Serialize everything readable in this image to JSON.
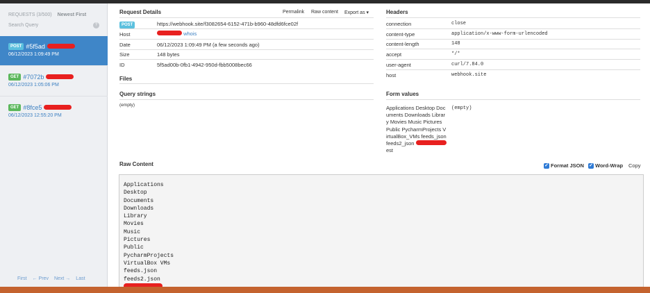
{
  "sidebar": {
    "requests_count": "REQUESTS (3/500)",
    "newest_first": "Newest First",
    "search_placeholder": "Search Query",
    "items": [
      {
        "method": "POST",
        "id": "#5f5ad",
        "time": "06/12/2023 1:09:49 PM",
        "active": true
      },
      {
        "method": "GET",
        "id": "#7072b",
        "time": "06/12/2023 1:05:06 PM",
        "active": false
      },
      {
        "method": "GET",
        "id": "#8fce5",
        "time": "06/12/2023 12:55:20 PM",
        "active": false
      }
    ],
    "pager": {
      "first": "First",
      "prev": "← Prev",
      "next": "Next →",
      "last": "Last"
    }
  },
  "request_details": {
    "title": "Request Details",
    "permalink": "Permalink",
    "raw_content_link": "Raw content",
    "export_as": "Export as ▾",
    "method_badge": "POST",
    "url": "https://webhook.site/f3082654-6152-471b-b960-48dfd6fce02f",
    "host_label": "Host",
    "host_whois": "whois",
    "date_label": "Date",
    "date_value": "06/12/2023 1:09:49 PM (a few seconds ago)",
    "size_label": "Size",
    "size_value": "148 bytes",
    "id_label": "ID",
    "id_value": "5f5ad00b-0fb1-4942-950d-fbb5008bec66"
  },
  "files": {
    "title": "Files"
  },
  "query_strings": {
    "title": "Query strings",
    "value": "(empty)"
  },
  "headers": {
    "title": "Headers",
    "rows": [
      {
        "key": "connection",
        "value": "close"
      },
      {
        "key": "content-type",
        "value": "application/x-www-form-urlencoded"
      },
      {
        "key": "content-length",
        "value": "148"
      },
      {
        "key": "accept",
        "value": "*/*"
      },
      {
        "key": "user-agent",
        "value": "curl/7.84.0"
      },
      {
        "key": "host",
        "value": "webhook.site"
      }
    ]
  },
  "form_values": {
    "title": "Form values",
    "key_lines": [
      "Applications Desktop Doc",
      "uments Downloads Librar",
      "y Movies Music Pictures",
      "Public PycharmProjects V",
      "irtualBox_VMs feeds_json",
      "feeds2_json",
      "est"
    ],
    "value": "(empty)"
  },
  "raw_content": {
    "title": "Raw Content",
    "format_json": "Format JSON",
    "word_wrap": "Word-Wrap",
    "copy": "Copy",
    "lines": [
      "Applications",
      "Desktop",
      "Documents",
      "Downloads",
      "Library",
      "Movies",
      "Music",
      "Pictures",
      "Public",
      "PycharmProjects",
      "VirtualBox VMs",
      "feeds.json",
      "feeds2.json"
    ]
  },
  "colors": {
    "accent": "#3f86c8",
    "post": "#5bc0de",
    "get": "#5cb85c",
    "redaction": "#e8201f"
  }
}
